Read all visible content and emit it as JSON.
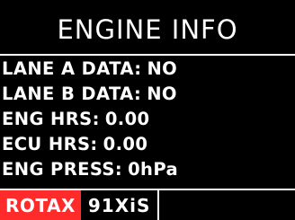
{
  "header": {
    "title": "ENGINE INFO"
  },
  "rows": [
    {
      "label": "LANE A DATA:",
      "value": "NO"
    },
    {
      "label": "LANE B DATA:",
      "value": "NO"
    },
    {
      "label": "ENG HRS:",
      "value": "0.00"
    },
    {
      "label": "ECU HRS:",
      "value": "0.00"
    },
    {
      "label": "ENG PRESS:",
      "value": "0hPa"
    }
  ],
  "footer": {
    "brand": "ROTAX",
    "model": "91XiS"
  },
  "colors": {
    "background": "#000000",
    "text": "#ffffff",
    "brand": "#ff2a2a"
  }
}
